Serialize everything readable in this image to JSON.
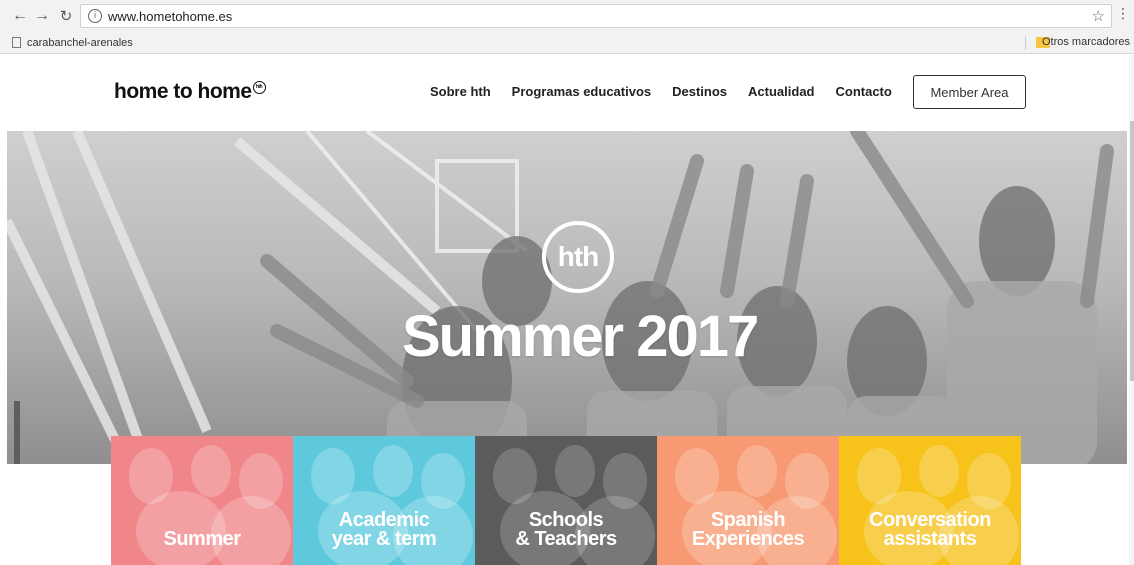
{
  "browser": {
    "url": "www.hometohome.es",
    "bookmark_item": "carabanchel-arenales",
    "other_bookmarks": "Otros marcadores"
  },
  "site": {
    "logo_text": "home to home",
    "logo_badge": "hth",
    "nav": [
      "Sobre hth",
      "Programas educativos",
      "Destinos",
      "Actualidad",
      "Contacto"
    ],
    "member_button": "Member Area"
  },
  "hero": {
    "badge": "hth",
    "title": "Summer 2017"
  },
  "tiles": [
    {
      "line1": "Summer",
      "line2": "",
      "color": "#f0868a"
    },
    {
      "line1": "Academic",
      "line2": "year & term",
      "color": "#5ec9dd"
    },
    {
      "line1": "Schools",
      "line2": "& Teachers",
      "color": "#5b5b5b"
    },
    {
      "line1": "Spanish",
      "line2": "Experiences",
      "color": "#f79a73"
    },
    {
      "line1": "Conversation",
      "line2": "assistants",
      "color": "#f7c21a"
    }
  ]
}
